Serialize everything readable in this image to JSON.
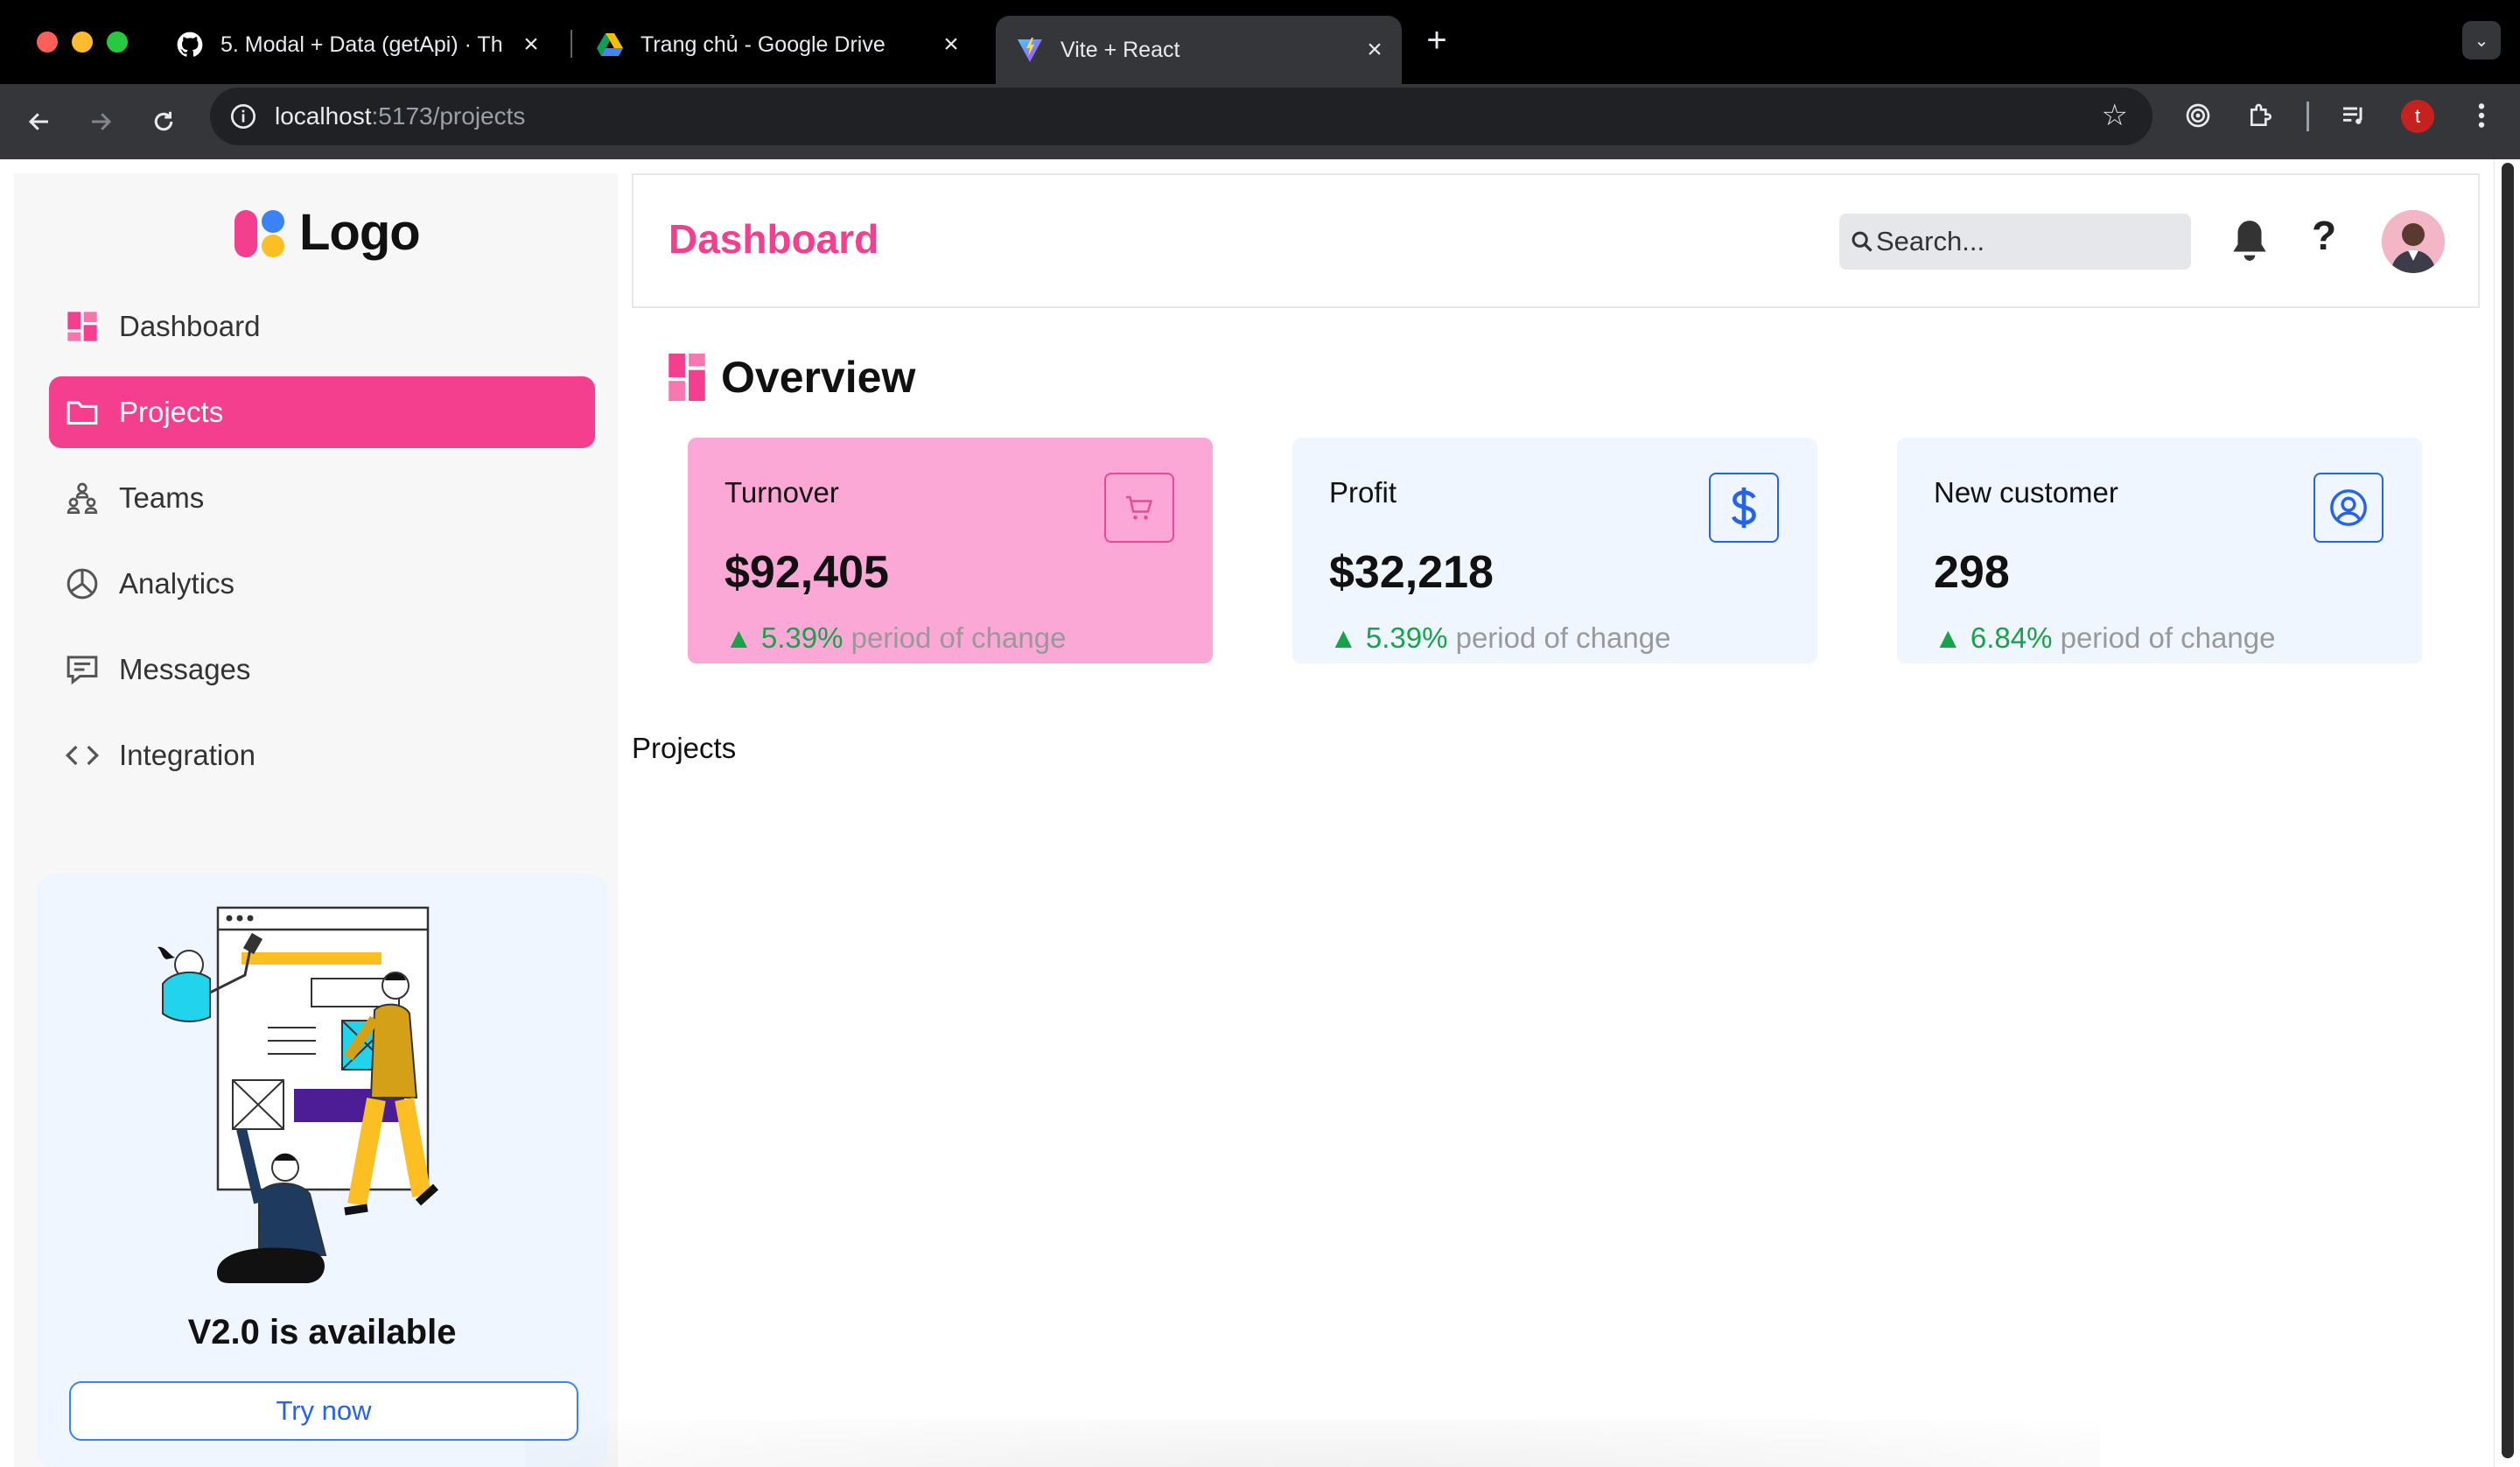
{
  "browser": {
    "tabs": [
      {
        "title": "5. Modal + Data (getApi) · Th",
        "icon": "github-icon"
      },
      {
        "title": "Trang chủ - Google Drive",
        "icon": "google-drive-icon"
      },
      {
        "title": "Vite + React",
        "icon": "vite-icon",
        "active": true
      }
    ],
    "new_tab": "+",
    "url_host": "localhost",
    "url_path": ":5173/projects",
    "profile_initial": "t"
  },
  "sidebar": {
    "logo_text": "Logo",
    "items": [
      {
        "label": "Dashboard",
        "icon": "dashboard-icon"
      },
      {
        "label": "Projects",
        "icon": "folder-icon",
        "active": true
      },
      {
        "label": "Teams",
        "icon": "teams-icon"
      },
      {
        "label": "Analytics",
        "icon": "analytics-icon"
      },
      {
        "label": "Messages",
        "icon": "messages-icon"
      },
      {
        "label": "Integration",
        "icon": "code-icon"
      }
    ],
    "promo": {
      "title": "V2.0 is available",
      "button": "Try now"
    }
  },
  "header": {
    "title": "Dashboard",
    "search_placeholder": "Search..."
  },
  "overview": {
    "title": "Overview",
    "cards": [
      {
        "label": "Turnover",
        "value": "$92,405",
        "change": "5.39%",
        "change_text": "period of change",
        "icon": "cart-icon"
      },
      {
        "label": "Profit",
        "value": "$32,218",
        "change": "5.39%",
        "change_text": "period of change",
        "icon": "dollar-icon"
      },
      {
        "label": "New customer",
        "value": "298",
        "change": "6.84%",
        "change_text": "period of change",
        "icon": "user-circle-icon"
      }
    ],
    "trend_arrow": "▲"
  },
  "projects": {
    "title": "Projects"
  },
  "colors": {
    "accent": "#f43f8e",
    "card_pink": "#fba8d6",
    "card_blue": "#eff6ff",
    "positive": "#16a34a",
    "link_blue": "#2563eb"
  }
}
